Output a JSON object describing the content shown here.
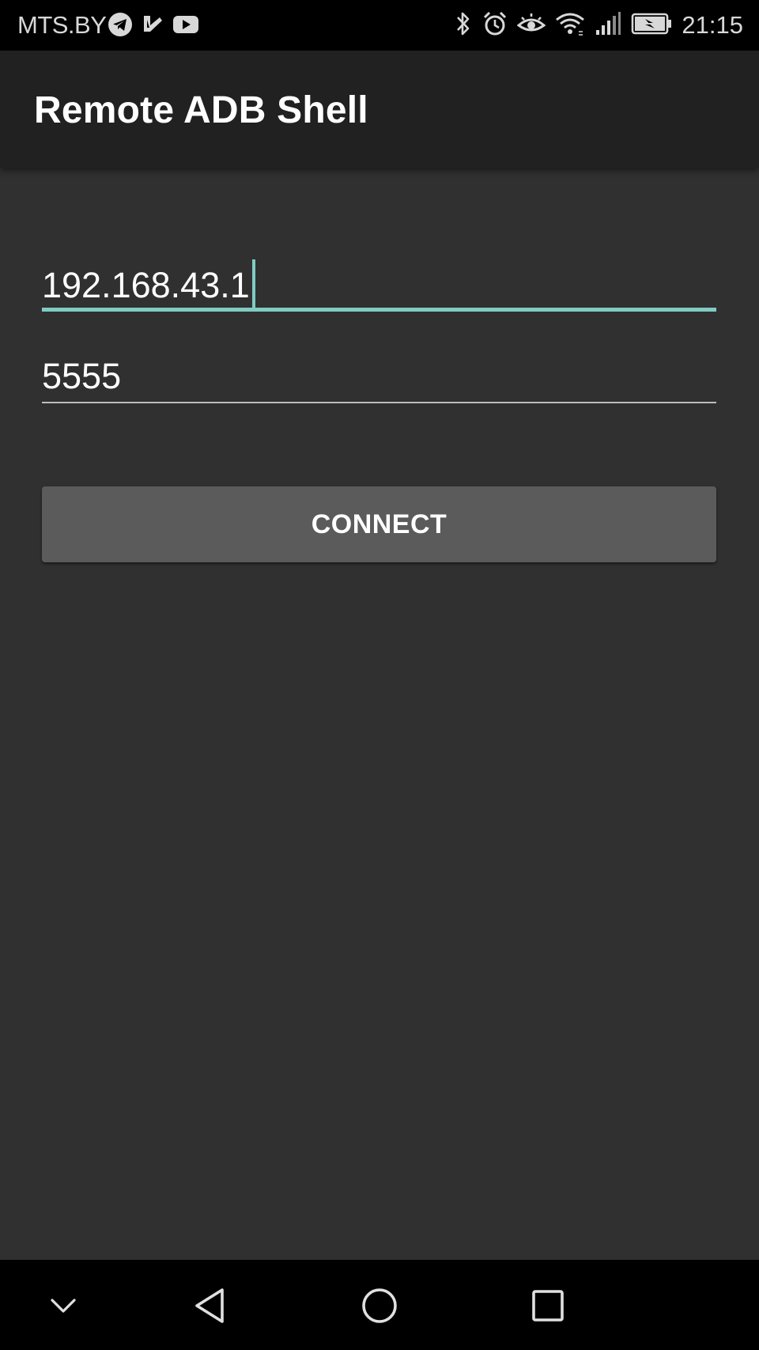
{
  "status_bar": {
    "carrier": "MTS.BY",
    "time": "21:15",
    "left_icons": [
      "telegram-icon",
      "tick-check-icon",
      "youtube-icon"
    ],
    "right_icons": [
      "bluetooth-icon",
      "alarm-icon",
      "eye-comfort-icon",
      "wifi-icon",
      "signal-icon",
      "battery-charging-icon"
    ]
  },
  "app_bar": {
    "title": "Remote ADB Shell"
  },
  "form": {
    "ip_value": "192.168.43.1",
    "port_value": "5555",
    "connect_label": "CONNECT"
  },
  "nav_bar": {
    "buttons": [
      "hide-keyboard-icon",
      "back-icon",
      "home-icon",
      "recents-icon"
    ]
  },
  "colors": {
    "background": "#303030",
    "app_bar": "#212121",
    "accent": "#80cbc4",
    "button": "#5b5b5c",
    "system_bars": "#000000"
  }
}
